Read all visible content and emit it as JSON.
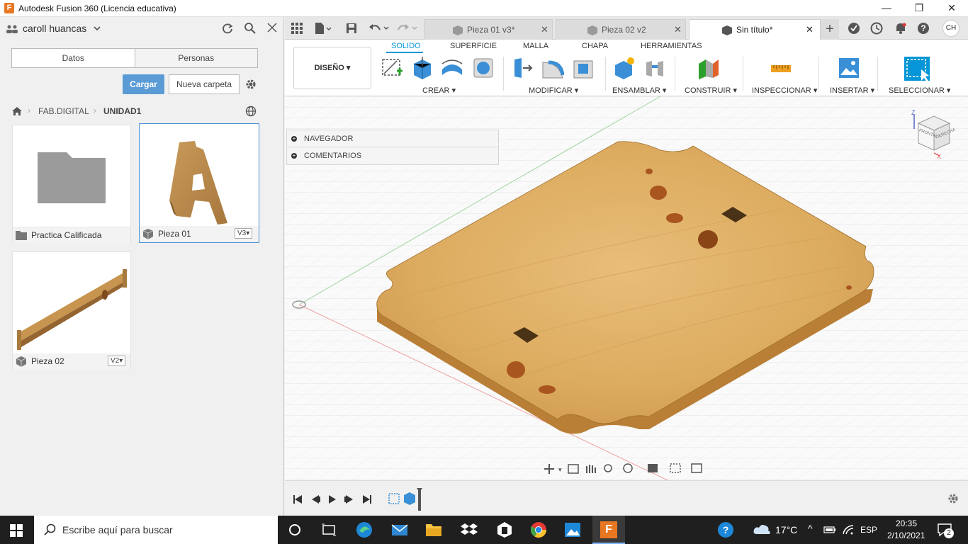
{
  "window": {
    "title": "Autodesk Fusion 360 (Licencia educativa)",
    "logo_letter": "F",
    "controls": {
      "minimize": "—",
      "maximize": "❐",
      "close": "✕"
    }
  },
  "left_panel": {
    "user_name": "caroll huancas",
    "tabs": [
      "Datos",
      "Personas"
    ],
    "upload_button": "Cargar",
    "new_folder_button": "Nueva carpeta",
    "breadcrumb": {
      "project": "FAB.DIGITAL",
      "folder": "UNIDAD1"
    },
    "items": [
      {
        "name": "Practica Calificada",
        "type": "folder",
        "version": ""
      },
      {
        "name": "Pieza 01",
        "type": "design",
        "version": "V3"
      },
      {
        "name": "Pieza 02",
        "type": "design",
        "version": "V2"
      }
    ]
  },
  "doc_tabs": [
    {
      "label": "Pieza 01 v3*",
      "active": false
    },
    {
      "label": "Pieza 02 v2",
      "active": false
    },
    {
      "label": "Sin título*",
      "active": true
    }
  ],
  "user_initials": "CH",
  "ribbon": {
    "workspace": "DISEÑO",
    "tabs": [
      {
        "label": "SOLIDO",
        "active": true
      },
      {
        "label": "SUPERFICIE",
        "active": false
      },
      {
        "label": "MALLA",
        "active": false
      },
      {
        "label": "CHAPA",
        "active": false
      },
      {
        "label": "HERRAMIENTAS",
        "active": false
      }
    ],
    "groups": [
      "CREAR",
      "MODIFICAR",
      "ENSAMBLAR",
      "CONSTRUIR",
      "INSPECCIONAR",
      "INSERTAR",
      "SELECCIONAR"
    ]
  },
  "browser": {
    "rows": [
      "NAVEGADOR",
      "COMENTARIOS"
    ]
  },
  "view_cube": {
    "face_front": "FRONTAL",
    "face_right": "DERECHA",
    "axis_z": "Z",
    "axis_x": "X"
  },
  "taskbar": {
    "search_placeholder": "Escribe aquí para buscar",
    "weather": "17°C",
    "language": "ESP",
    "time": "20:35",
    "date": "2/10/2021",
    "notifications": "2"
  },
  "colors": {
    "accent": "#0696d7",
    "upload_button": "#5b9bd5",
    "taskbar": "#1f1f1f",
    "wood_light": "#e2b46c",
    "wood_dark": "#c88e43"
  }
}
